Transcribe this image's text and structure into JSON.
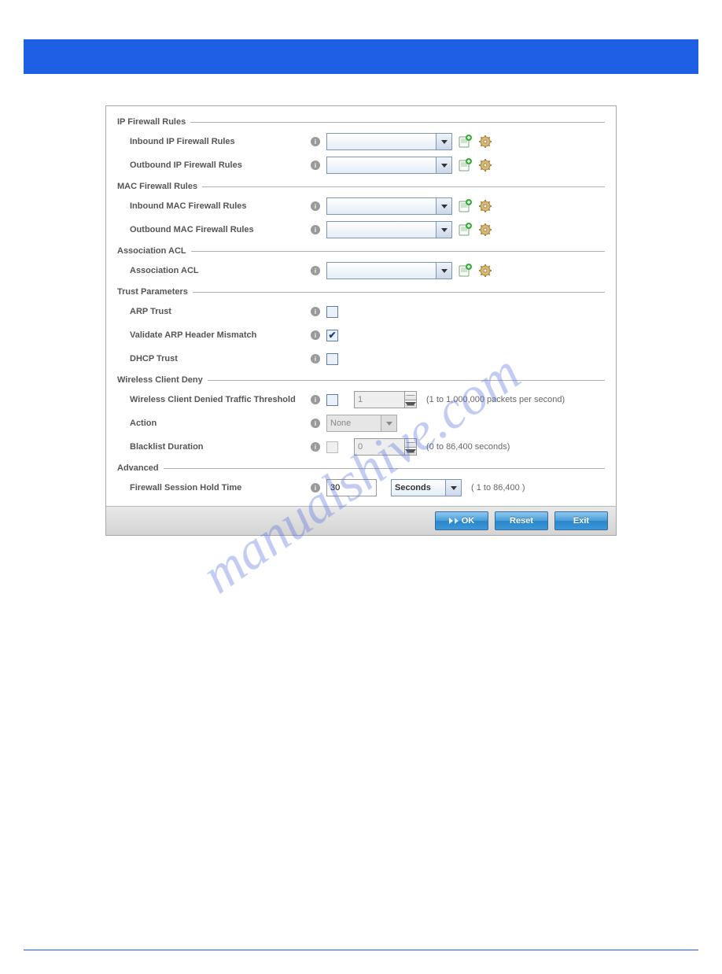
{
  "watermark": "manualshive.com",
  "sections": {
    "ip_firewall": "IP Firewall Rules",
    "mac_firewall": "MAC Firewall Rules",
    "assoc_acl": "Association ACL",
    "trust": "Trust Parameters",
    "wcd": "Wireless Client Deny",
    "advanced": "Advanced"
  },
  "rows": {
    "inbound_ip": "Inbound IP Firewall Rules",
    "outbound_ip": "Outbound IP Firewall Rules",
    "inbound_mac": "Inbound MAC Firewall Rules",
    "outbound_mac": "Outbound MAC Firewall Rules",
    "assoc_acl_row": "Association ACL",
    "arp_trust": "ARP Trust",
    "arp_mismatch": "Validate ARP Header Mismatch",
    "dhcp_trust": "DHCP Trust",
    "wcd_threshold": "Wireless Client Denied Traffic Threshold",
    "action": "Action",
    "blacklist": "Blacklist Duration",
    "hold_time": "Firewall Session Hold Time"
  },
  "values": {
    "inbound_ip": "",
    "outbound_ip": "",
    "inbound_mac": "",
    "outbound_mac": "",
    "assoc_acl": "",
    "arp_trust_checked": false,
    "arp_mismatch_checked": true,
    "dhcp_trust_checked": false,
    "wcd_enable_checked": false,
    "wcd_threshold": "1",
    "action": "None",
    "blacklist_enable_checked": false,
    "blacklist": "0",
    "hold_time": "30",
    "hold_time_unit": "Seconds"
  },
  "hints": {
    "wcd_threshold": "(1 to 1,000,000 packets per second)",
    "blacklist": "(0 to 86,400 seconds)",
    "hold_time": "( 1 to 86,400 )"
  },
  "buttons": {
    "ok": "OK",
    "reset": "Reset",
    "exit": "Exit"
  },
  "info_glyph": "i"
}
